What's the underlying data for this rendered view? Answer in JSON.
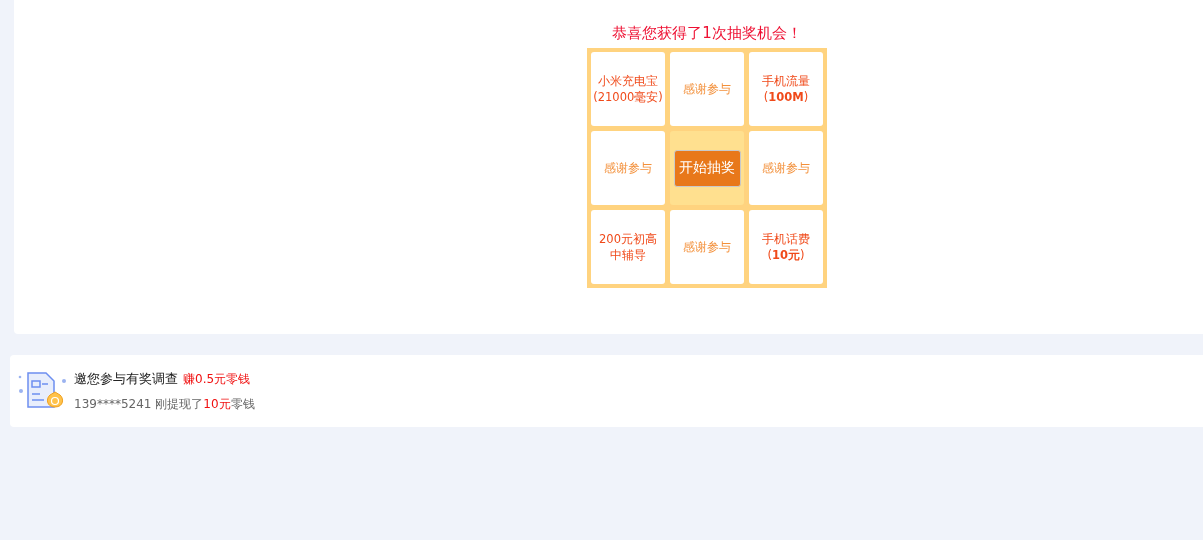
{
  "lottery": {
    "title": "恭喜您获得了1次抽奖机会！",
    "cells": [
      {
        "kind": "prize",
        "lines": [
          "小米充电宝",
          "(21000毫安)"
        ]
      },
      {
        "kind": "thanks",
        "lines": [
          "感谢参与"
        ]
      },
      {
        "kind": "prize",
        "lines": [
          "手机流量",
          "(**100M**)"
        ]
      },
      {
        "kind": "thanks",
        "lines": [
          "感谢参与"
        ]
      },
      {
        "kind": "start",
        "lines": [
          "开始抽奖"
        ]
      },
      {
        "kind": "thanks",
        "lines": [
          "感谢参与"
        ]
      },
      {
        "kind": "prize",
        "lines": [
          "200元初高",
          "中辅导"
        ]
      },
      {
        "kind": "thanks",
        "lines": [
          "感谢参与"
        ]
      },
      {
        "kind": "prize",
        "lines": [
          "手机话费",
          "(**10元**)"
        ]
      }
    ]
  },
  "survey": {
    "title": "邀您参与有奖调查",
    "reward": "赚0.5元零钱",
    "notice": {
      "before": "139****5241 刚提现了",
      "amount": "10元",
      "after": "零钱"
    }
  }
}
